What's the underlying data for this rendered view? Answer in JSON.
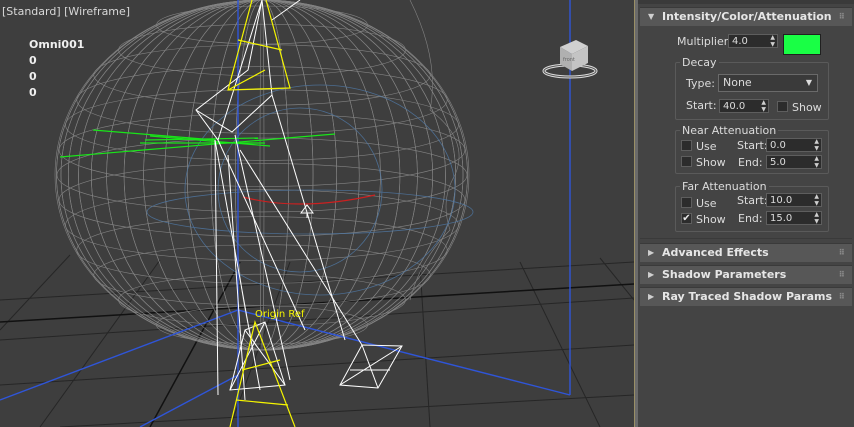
{
  "viewport": {
    "label_standard": "[Standard]",
    "label_wireframe": "[Wireframe]",
    "stats": [
      "Omni001",
      "0",
      "0",
      "0"
    ],
    "origin_label": "Origin Ref"
  },
  "panel": {
    "intensity": {
      "title": "Intensity/Color/Attenuation",
      "multiplier_label": "Multiplier:",
      "multiplier_value": "4.0",
      "color": "#19ff45",
      "decay_title": "Decay",
      "type_label": "Type:",
      "type_value": "None",
      "start_label": "Start:",
      "start_value": "40.0",
      "show_label": "Show",
      "near_title": "Near Attenuation",
      "near_use_label": "Use",
      "near_show_label": "Show",
      "near_start_label": "Start:",
      "near_start_value": "0.0",
      "near_end_label": "End:",
      "near_end_value": "5.0",
      "far_title": "Far Attenuation",
      "far_use_label": "Use",
      "far_show_label": "Show",
      "far_start_label": "Start:",
      "far_start_value": "10.0",
      "far_end_label": "End:",
      "far_end_value": "15.0"
    },
    "rollouts": [
      {
        "title": "Advanced Effects"
      },
      {
        "title": "Shadow Parameters"
      },
      {
        "title": "Ray Traced Shadow Params"
      }
    ]
  },
  "colors": {
    "viewport_bg": "#3e3e3e",
    "wire": "#9a9a9a",
    "light_white": "#ffffff",
    "light_yellow": "#f5f500",
    "gizmo_green": "#19e619",
    "bbox_blue": "#2f55d8"
  },
  "icons": {
    "checkmark": "✔",
    "dropdown": "▼",
    "expand": "▶",
    "collapse": "▼",
    "spin": "▲▼"
  }
}
